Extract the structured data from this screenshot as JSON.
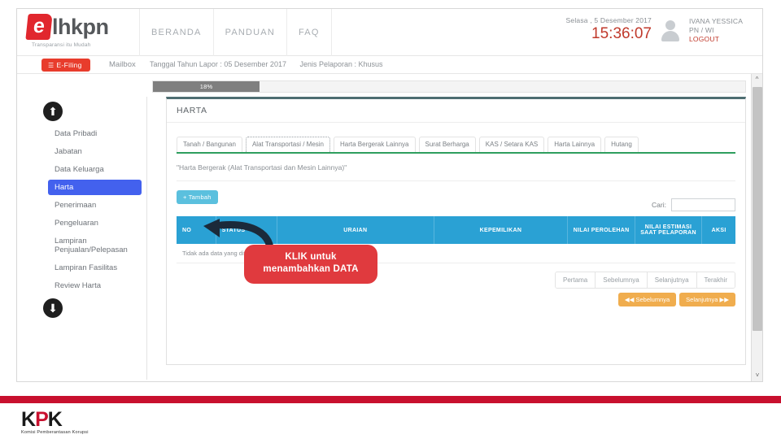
{
  "brand": {
    "logo_letter": "e",
    "logo_text": "lhkpn",
    "tagline": "Transparansi itu Mudah"
  },
  "topnav": {
    "items": [
      {
        "label": "BERANDA",
        "name": "beranda"
      },
      {
        "label": "PANDUAN",
        "name": "panduan"
      },
      {
        "label": "FAQ",
        "name": "faq"
      }
    ]
  },
  "header_right": {
    "date": "Selasa , 5 Desember 2017",
    "time": "15:36:07",
    "avatar_icon": "user-avatar-icon",
    "user_name": "IVANA YESSICA",
    "user_role": "PN / WI",
    "logout_label": "LOGOUT"
  },
  "subbar": {
    "efiling_label": "E-Filing",
    "efiling_icon": "hamburger-icon",
    "mailbox_label": "Mailbox",
    "tanggal_lapor": "Tanggal Tahun Lapor : 05 Desember 2017",
    "jenis_pelaporan": "Jenis Pelaporan : Khusus"
  },
  "progress": {
    "percent_label": "18%",
    "percent_value": 18
  },
  "sidebar": {
    "scroll_up_icon": "arrow-up-circle-icon",
    "scroll_down_icon": "arrow-down-circle-icon",
    "items": [
      {
        "label": "Data Pribadi",
        "name": "data-pribadi",
        "active": false
      },
      {
        "label": "Jabatan",
        "name": "jabatan",
        "active": false
      },
      {
        "label": "Data Keluarga",
        "name": "data-keluarga",
        "active": false
      },
      {
        "label": "Harta",
        "name": "harta",
        "active": true
      },
      {
        "label": "Penerimaan",
        "name": "penerimaan",
        "active": false
      },
      {
        "label": "Pengeluaran",
        "name": "pengeluaran",
        "active": false
      },
      {
        "label": "Lampiran Penjualan/Pelepasan",
        "name": "lampiran-penjualan",
        "active": false
      },
      {
        "label": "Lampiran Fasilitas",
        "name": "lampiran-fasilitas",
        "active": false
      },
      {
        "label": "Review Harta",
        "name": "review-harta",
        "active": false
      }
    ]
  },
  "panel": {
    "title": "HARTA",
    "tabs": [
      {
        "label": "Tanah / Bangunan",
        "name": "tanah-bangunan",
        "active": false
      },
      {
        "label": "Alat Transportasi / Mesin",
        "name": "alat-transportasi-mesin",
        "active": true
      },
      {
        "label": "Harta Bergerak Lainnya",
        "name": "harta-bergerak-lainnya",
        "active": false
      },
      {
        "label": "Surat Berharga",
        "name": "surat-berharga",
        "active": false
      },
      {
        "label": "KAS / Setara KAS",
        "name": "kas-setara-kas",
        "active": false
      },
      {
        "label": "Harta Lainnya",
        "name": "harta-lainnya",
        "active": false
      },
      {
        "label": "Hutang",
        "name": "hutang",
        "active": false
      }
    ],
    "section_caption": "\"Harta Bergerak (Alat Transportasi dan Mesin Lainnya)\"",
    "add_button_label": "+ Tambah",
    "search_label": "Cari:",
    "search_value": "",
    "search_placeholder": ""
  },
  "table": {
    "columns": [
      {
        "label": "NO",
        "name": "no",
        "align": "left",
        "width": "7%"
      },
      {
        "label": "STATUS",
        "name": "status",
        "align": "left",
        "width": "11%"
      },
      {
        "label": "URAIAN",
        "name": "uraian",
        "align": "center",
        "width": "28%"
      },
      {
        "label": "KEPEMILIKAN",
        "name": "kepemilikan",
        "align": "center",
        "width": "24%"
      },
      {
        "label": "NILAI PEROLEHAN",
        "name": "nilai-perolehan",
        "align": "center",
        "width": "12%"
      },
      {
        "label": "NILAI ESTIMASI SAAT PELAPORAN",
        "name": "nilai-estimasi",
        "align": "center",
        "width": "12%"
      },
      {
        "label": "AKSI",
        "name": "aksi",
        "align": "center",
        "width": "6%"
      }
    ],
    "rows": [],
    "empty_message": "Tidak ada data yang ditampilkan"
  },
  "pagination": {
    "links": [
      {
        "label": "Pertama",
        "name": "pertama"
      },
      {
        "label": "Sebelumnya",
        "name": "sebelumnya"
      },
      {
        "label": "Selanjutnya",
        "name": "selanjutnya"
      },
      {
        "label": "Terakhir",
        "name": "terakhir"
      }
    ],
    "prev_button_label": "◀◀ Sebelumnya",
    "next_button_label": "Selanjutnya ▶▶"
  },
  "callout": {
    "line1": "KLIK untuk",
    "line2": "menambahkan DATA",
    "color": "#e03a3e"
  },
  "scrollbar": {
    "up_icon": "chevron-up-icon",
    "down_icon": "chevron-down-icon"
  },
  "footer": {
    "logo_k1": "K",
    "logo_p": "P",
    "logo_k2": "K",
    "subtitle": "Komisi Pemberantasan Korupsi",
    "rule_color": "#c8102e"
  }
}
